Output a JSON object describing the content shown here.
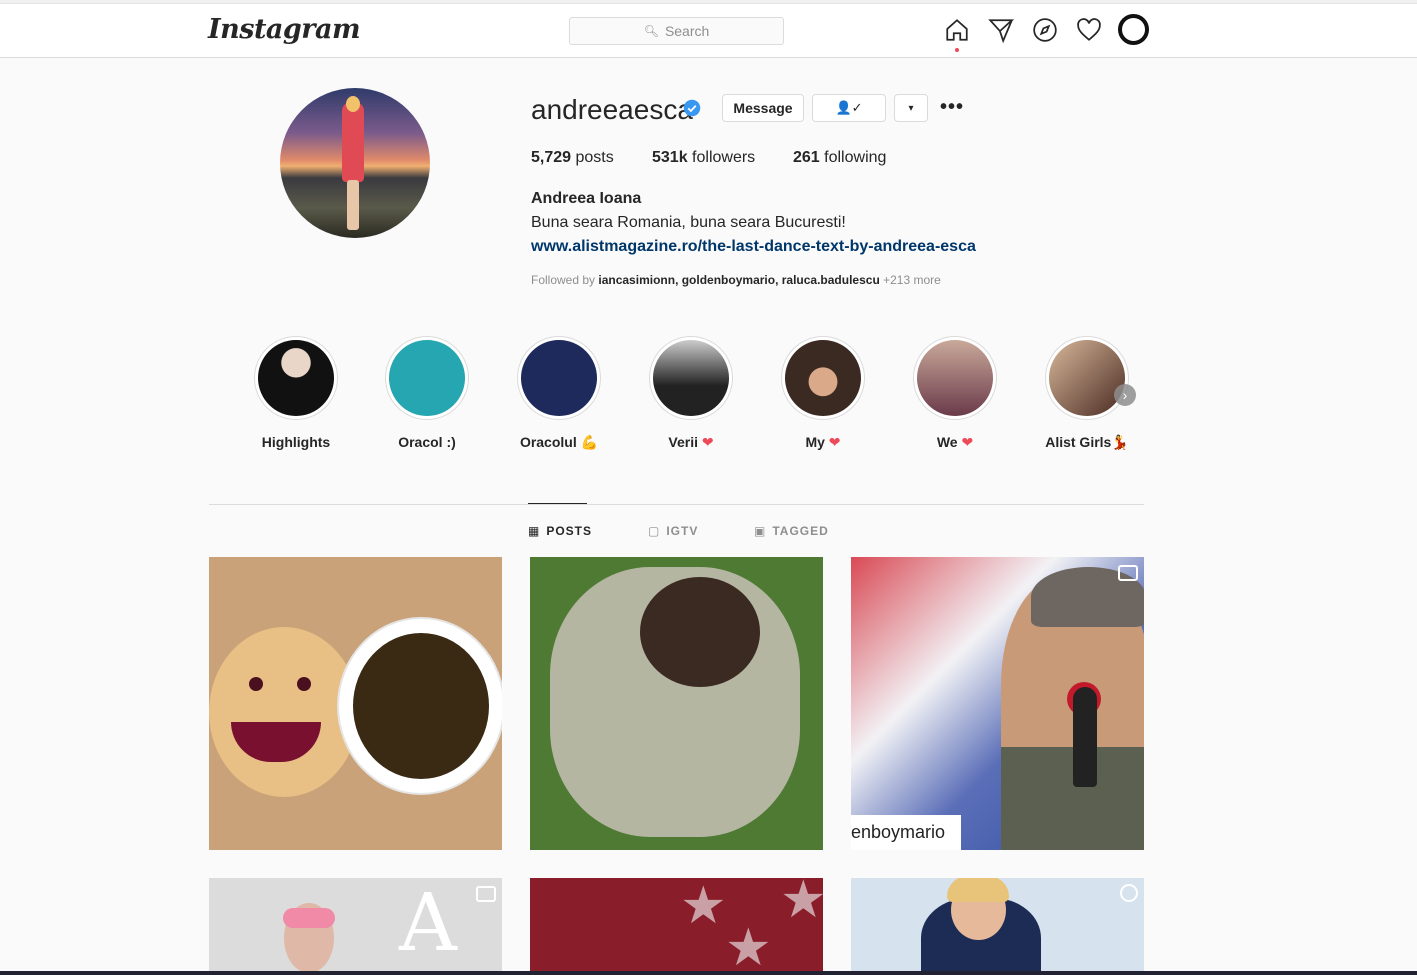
{
  "nav": {
    "logo": "Instagram",
    "search_placeholder": "Search",
    "icons": [
      "home-icon",
      "direct-icon",
      "explore-icon",
      "activity-icon",
      "profile-avatar"
    ]
  },
  "profile": {
    "username": "andreeaesca",
    "verified": true,
    "buttons": {
      "message": "Message",
      "follow_icon": "👤✓",
      "dropdown": "▾",
      "more": "•••"
    },
    "stats": [
      {
        "value": "5,729",
        "label": "posts"
      },
      {
        "value": "531k",
        "label": "followers"
      },
      {
        "value": "261",
        "label": "following"
      }
    ],
    "full_name": "Andreea Ioana",
    "bio": "Buna seara Romania, buna seara Bucuresti!",
    "link": "www.alistmagazine.ro/the-last-dance-text-by-andreea-esca",
    "followed_by_prefix": "Followed by",
    "followed_by_names": "iancasimionn, goldenboymario, raluca.badulescu",
    "followed_by_more": "+213 more"
  },
  "highlights": [
    {
      "label": "Highlights",
      "emoji": ""
    },
    {
      "label": "Oracol :)",
      "emoji": ""
    },
    {
      "label": "Oracolul",
      "emoji": "💪"
    },
    {
      "label": "Verii",
      "emoji": "❤"
    },
    {
      "label": "My",
      "emoji": "❤"
    },
    {
      "label": "We",
      "emoji": "❤"
    },
    {
      "label": "Alist Girls",
      "emoji": "💃"
    }
  ],
  "tabs": [
    {
      "label": "POSTS",
      "icon": "grid-icon",
      "active": true
    },
    {
      "label": "IGTV",
      "icon": "igtv-icon",
      "active": false
    },
    {
      "label": "TAGGED",
      "icon": "tagged-icon",
      "active": false
    }
  ],
  "posts": {
    "p3_overlay_text": "enboymario",
    "p4_overlay_letter": "A"
  },
  "colors": {
    "link": "#00376b",
    "verified": "#3897f0",
    "notification_dot": "#ed4956",
    "secondary_text": "#8e8e8e",
    "border": "#dbdbdb"
  }
}
